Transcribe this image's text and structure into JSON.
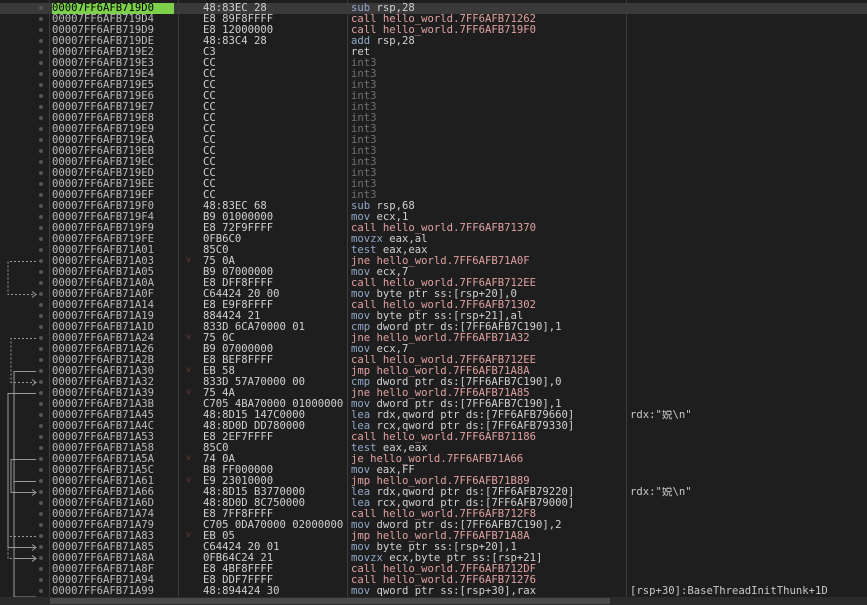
{
  "colors": {
    "selection_addr_bg": "#7cd04a",
    "call_jmp": "#e0a0a0",
    "mnemonic": "#8fa7c9",
    "int3": "#707070"
  },
  "rows": [
    {
      "addr": "00007FF6AFB719D0",
      "bytes": "48:83EC 28",
      "mn": "sub",
      "ops": "rsp,28",
      "kind": "mn",
      "sel": true
    },
    {
      "addr": "00007FF6AFB719D4",
      "bytes": "E8 89F8FFFF",
      "mn": "call",
      "ops": "hello_world.7FF6AFB71262",
      "kind": "call"
    },
    {
      "addr": "00007FF6AFB719D9",
      "bytes": "E8 12000000",
      "mn": "call",
      "ops": "hello_world.7FF6AFB719F0",
      "kind": "call"
    },
    {
      "addr": "00007FF6AFB719DE",
      "bytes": "48:83C4 28",
      "mn": "add",
      "ops": "rsp,28",
      "kind": "mn"
    },
    {
      "addr": "00007FF6AFB719E2",
      "bytes": "C3",
      "mn": "ret",
      "ops": "",
      "kind": "ret"
    },
    {
      "addr": "00007FF6AFB719E3",
      "bytes": "CC",
      "mn": "int3",
      "ops": "",
      "kind": "int3"
    },
    {
      "addr": "00007FF6AFB719E4",
      "bytes": "CC",
      "mn": "int3",
      "ops": "",
      "kind": "int3"
    },
    {
      "addr": "00007FF6AFB719E5",
      "bytes": "CC",
      "mn": "int3",
      "ops": "",
      "kind": "int3"
    },
    {
      "addr": "00007FF6AFB719E6",
      "bytes": "CC",
      "mn": "int3",
      "ops": "",
      "kind": "int3"
    },
    {
      "addr": "00007FF6AFB719E7",
      "bytes": "CC",
      "mn": "int3",
      "ops": "",
      "kind": "int3"
    },
    {
      "addr": "00007FF6AFB719E8",
      "bytes": "CC",
      "mn": "int3",
      "ops": "",
      "kind": "int3"
    },
    {
      "addr": "00007FF6AFB719E9",
      "bytes": "CC",
      "mn": "int3",
      "ops": "",
      "kind": "int3"
    },
    {
      "addr": "00007FF6AFB719EA",
      "bytes": "CC",
      "mn": "int3",
      "ops": "",
      "kind": "int3"
    },
    {
      "addr": "00007FF6AFB719EB",
      "bytes": "CC",
      "mn": "int3",
      "ops": "",
      "kind": "int3"
    },
    {
      "addr": "00007FF6AFB719EC",
      "bytes": "CC",
      "mn": "int3",
      "ops": "",
      "kind": "int3"
    },
    {
      "addr": "00007FF6AFB719ED",
      "bytes": "CC",
      "mn": "int3",
      "ops": "",
      "kind": "int3"
    },
    {
      "addr": "00007FF6AFB719EE",
      "bytes": "CC",
      "mn": "int3",
      "ops": "",
      "kind": "int3"
    },
    {
      "addr": "00007FF6AFB719EF",
      "bytes": "CC",
      "mn": "int3",
      "ops": "",
      "kind": "int3"
    },
    {
      "addr": "00007FF6AFB719F0",
      "bytes": "48:83EC 68",
      "mn": "sub",
      "ops": "rsp,68",
      "kind": "mn"
    },
    {
      "addr": "00007FF6AFB719F4",
      "bytes": "B9 01000000",
      "mn": "mov",
      "ops": "ecx,1",
      "kind": "mn"
    },
    {
      "addr": "00007FF6AFB719F9",
      "bytes": "E8 72F9FFFF",
      "mn": "call",
      "ops": "hello_world.7FF6AFB71370",
      "kind": "call"
    },
    {
      "addr": "00007FF6AFB719FE",
      "bytes": "0FB6C0",
      "mn": "movzx",
      "ops": "eax,al",
      "kind": "mn"
    },
    {
      "addr": "00007FF6AFB71A01",
      "bytes": "85C0",
      "mn": "test",
      "ops": "eax,eax",
      "kind": "mn"
    },
    {
      "addr": "00007FF6AFB71A03",
      "bytes": "75 0A",
      "mn": "jne",
      "ops": "hello_world.7FF6AFB71A0F",
      "kind": "jcc",
      "arrow": "v"
    },
    {
      "addr": "00007FF6AFB71A05",
      "bytes": "B9 07000000",
      "mn": "mov",
      "ops": "ecx,7",
      "kind": "mn"
    },
    {
      "addr": "00007FF6AFB71A0A",
      "bytes": "E8 DFF8FFFF",
      "mn": "call",
      "ops": "hello_world.7FF6AFB712EE",
      "kind": "call"
    },
    {
      "addr": "00007FF6AFB71A0F",
      "bytes": "C64424 20 00",
      "mn": "mov",
      "ops": "byte ptr ss:[rsp+20],0",
      "kind": "mn"
    },
    {
      "addr": "00007FF6AFB71A14",
      "bytes": "E8 E9F8FFFF",
      "mn": "call",
      "ops": "hello_world.7FF6AFB71302",
      "kind": "call"
    },
    {
      "addr": "00007FF6AFB71A19",
      "bytes": "884424 21",
      "mn": "mov",
      "ops": "byte ptr ss:[rsp+21],al",
      "kind": "mn"
    },
    {
      "addr": "00007FF6AFB71A1D",
      "bytes": "833D 6CA70000 01",
      "mn": "cmp",
      "ops": "dword ptr ds:[7FF6AFB7C190],1",
      "kind": "mn"
    },
    {
      "addr": "00007FF6AFB71A24",
      "bytes": "75 0C",
      "mn": "jne",
      "ops": "hello_world.7FF6AFB71A32",
      "kind": "jcc",
      "arrow": "v"
    },
    {
      "addr": "00007FF6AFB71A26",
      "bytes": "B9 07000000",
      "mn": "mov",
      "ops": "ecx,7",
      "kind": "mn"
    },
    {
      "addr": "00007FF6AFB71A2B",
      "bytes": "E8 BEF8FFFF",
      "mn": "call",
      "ops": "hello_world.7FF6AFB712EE",
      "kind": "call"
    },
    {
      "addr": "00007FF6AFB71A30",
      "bytes": "EB 58",
      "mn": "jmp",
      "ops": "hello_world.7FF6AFB71A8A",
      "kind": "jmp",
      "arrow": "v"
    },
    {
      "addr": "00007FF6AFB71A32",
      "bytes": "833D 57A70000 00",
      "mn": "cmp",
      "ops": "dword ptr ds:[7FF6AFB7C190],0",
      "kind": "mn"
    },
    {
      "addr": "00007FF6AFB71A39",
      "bytes": "75 4A",
      "mn": "jne",
      "ops": "hello_world.7FF6AFB71A85",
      "kind": "jcc",
      "arrow": "v"
    },
    {
      "addr": "00007FF6AFB71A3B",
      "bytes": "C705 4BA70000 01000000",
      "mn": "mov",
      "ops": "dword ptr ds:[7FF6AFB7C190],1",
      "kind": "mn"
    },
    {
      "addr": "00007FF6AFB71A45",
      "bytes": "48:8D15 147C0000",
      "mn": "lea",
      "ops": "rdx,qword ptr ds:[7FF6AFB79660]",
      "kind": "mn",
      "comment": "rdx:\"娧\\n\""
    },
    {
      "addr": "00007FF6AFB71A4C",
      "bytes": "48:8D0D DD780000",
      "mn": "lea",
      "ops": "rcx,qword ptr ds:[7FF6AFB79330]",
      "kind": "mn"
    },
    {
      "addr": "00007FF6AFB71A53",
      "bytes": "E8 2EF7FFFF",
      "mn": "call",
      "ops": "hello_world.7FF6AFB71186",
      "kind": "call"
    },
    {
      "addr": "00007FF6AFB71A58",
      "bytes": "85C0",
      "mn": "test",
      "ops": "eax,eax",
      "kind": "mn"
    },
    {
      "addr": "00007FF6AFB71A5A",
      "bytes": "74 0A",
      "mn": "je",
      "ops": "hello_world.7FF6AFB71A66",
      "kind": "jcc",
      "arrow": "v"
    },
    {
      "addr": "00007FF6AFB71A5C",
      "bytes": "B8 FF000000",
      "mn": "mov",
      "ops": "eax,FF",
      "kind": "mn"
    },
    {
      "addr": "00007FF6AFB71A61",
      "bytes": "E9 23010000",
      "mn": "jmp",
      "ops": "hello_world.7FF6AFB71B89",
      "kind": "jmp",
      "arrow": "v"
    },
    {
      "addr": "00007FF6AFB71A66",
      "bytes": "48:8D15 B3770000",
      "mn": "lea",
      "ops": "rdx,qword ptr ds:[7FF6AFB79220]",
      "kind": "mn",
      "comment": "rdx:\"娧\\n\""
    },
    {
      "addr": "00007FF6AFB71A6D",
      "bytes": "48:8D0D 8C750000",
      "mn": "lea",
      "ops": "rcx,qword ptr ds:[7FF6AFB79000]",
      "kind": "mn"
    },
    {
      "addr": "00007FF6AFB71A74",
      "bytes": "E8 7FF8FFFF",
      "mn": "call",
      "ops": "hello_world.7FF6AFB712F8",
      "kind": "call"
    },
    {
      "addr": "00007FF6AFB71A79",
      "bytes": "C705 0DA70000 02000000",
      "mn": "mov",
      "ops": "dword ptr ds:[7FF6AFB7C190],2",
      "kind": "mn"
    },
    {
      "addr": "00007FF6AFB71A83",
      "bytes": "EB 05",
      "mn": "jmp",
      "ops": "hello_world.7FF6AFB71A8A",
      "kind": "jmp",
      "arrow": "v"
    },
    {
      "addr": "00007FF6AFB71A85",
      "bytes": "C64424 20 01",
      "mn": "mov",
      "ops": "byte ptr ss:[rsp+20],1",
      "kind": "mn"
    },
    {
      "addr": "00007FF6AFB71A8A",
      "bytes": "0FB64C24 21",
      "mn": "movzx",
      "ops": "ecx,byte ptr ss:[rsp+21]",
      "kind": "mn"
    },
    {
      "addr": "00007FF6AFB71A8F",
      "bytes": "E8 4BF8FFFF",
      "mn": "call",
      "ops": "hello_world.7FF6AFB712DF",
      "kind": "call"
    },
    {
      "addr": "00007FF6AFB71A94",
      "bytes": "E8 DDF7FFFF",
      "mn": "call",
      "ops": "hello_world.7FF6AFB71276",
      "kind": "call"
    },
    {
      "addr": "00007FF6AFB71A99",
      "bytes": "48:894424 30",
      "mn": "mov",
      "ops": "qword ptr ss:[rsp+30],rax",
      "kind": "mn",
      "comment": "[rsp+30]:BaseThreadInitThunk+1D"
    }
  ]
}
